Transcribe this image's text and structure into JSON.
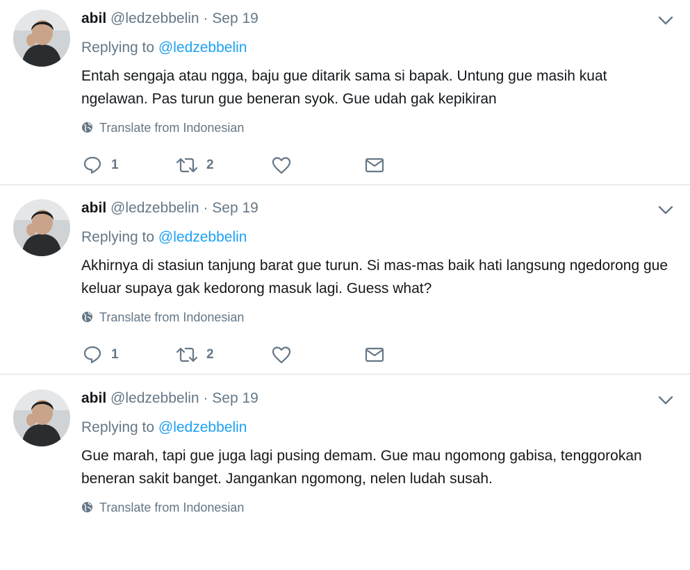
{
  "colors": {
    "text": "#14171a",
    "secondary": "#657786",
    "link": "#1da1f2",
    "divider": "#e6ecf0"
  },
  "icons": {
    "reply": "reply-icon",
    "retweet": "retweet-icon",
    "like": "like-icon",
    "direct_message": "direct-message-icon",
    "translate": "globe-icon",
    "more": "chevron-down-icon"
  },
  "tweets": [
    {
      "name": "abil",
      "handle": "@ledzebbelin",
      "separator": "·",
      "date": "Sep 19",
      "replying_prefix": "Replying to",
      "replying_to": "@ledzebbelin",
      "text": "Entah sengaja atau ngga, baju gue ditarik sama si bapak. Untung gue masih kuat ngelawan. Pas turun gue beneran syok. Gue udah gak kepikiran",
      "translate_label": "Translate from Indonesian",
      "reply_count": "1",
      "retweet_count": "2"
    },
    {
      "name": "abil",
      "handle": "@ledzebbelin",
      "separator": "·",
      "date": "Sep 19",
      "replying_prefix": "Replying to",
      "replying_to": "@ledzebbelin",
      "text": "Akhirnya di stasiun tanjung barat gue turun. Si mas-mas baik hati langsung ngedorong gue keluar supaya gak kedorong masuk lagi. Guess what?",
      "translate_label": "Translate from Indonesian",
      "reply_count": "1",
      "retweet_count": "2"
    },
    {
      "name": "abil",
      "handle": "@ledzebbelin",
      "separator": "·",
      "date": "Sep 19",
      "replying_prefix": "Replying to",
      "replying_to": "@ledzebbelin",
      "text": "Gue marah, tapi gue juga lagi pusing demam. Gue mau ngomong gabisa, tenggorokan beneran sakit banget. Jangankan ngomong, nelen ludah susah.",
      "translate_label": "Translate from Indonesian"
    }
  ]
}
